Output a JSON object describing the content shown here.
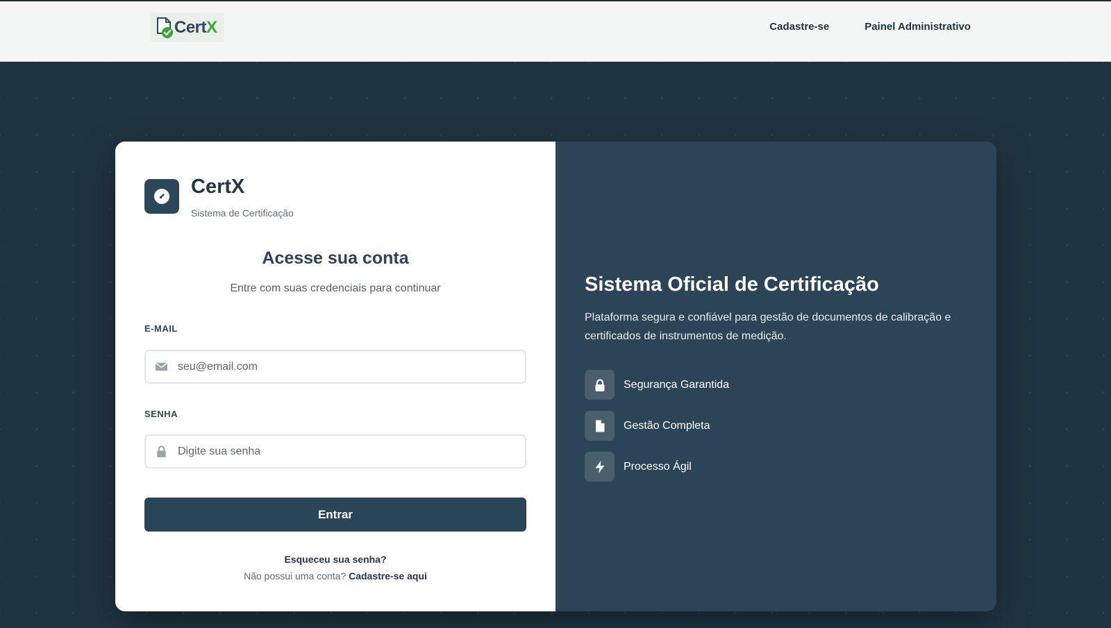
{
  "topbar": {
    "brand": {
      "cert": "Cert",
      "x": "X",
      "icon": "document-check-icon"
    },
    "nav": {
      "register": "Cadastre-se",
      "admin": "Painel Administrativo"
    }
  },
  "login": {
    "logo": {
      "icon": "gauge-icon",
      "title": "CertX",
      "subtitle": "Sistema de Certificação"
    },
    "heading": "Acesse sua conta",
    "subheading": "Entre com suas credenciais para continuar",
    "email": {
      "label": "E-MAIL",
      "placeholder": "seu@email.com",
      "value": "",
      "icon": "envelope-icon"
    },
    "password": {
      "label": "SENHA",
      "placeholder": "Digite sua senha",
      "value": "",
      "icon": "lock-icon"
    },
    "submit_label": "Entrar",
    "forgot_label": "Esqueceu sua senha?",
    "no_account_text": "Não possui uma conta?",
    "signup_link": "Cadastre-se aqui"
  },
  "info": {
    "title": "Sistema Oficial de Certificação",
    "description": "Plataforma segura e confiável para gestão de documentos de calibração e certificados de instrumentos de medição.",
    "features": [
      {
        "icon": "lock-icon",
        "label": "Segurança Garantida"
      },
      {
        "icon": "file-icon",
        "label": "Gestão Completa"
      },
      {
        "icon": "bolt-icon",
        "label": "Processo Ágil"
      }
    ]
  },
  "colors": {
    "background": "#1f3442",
    "panel_dark": "#2b4456",
    "primary": "#2b4558",
    "accent_green": "#3da33b",
    "topbar": "#f3f6f5"
  }
}
